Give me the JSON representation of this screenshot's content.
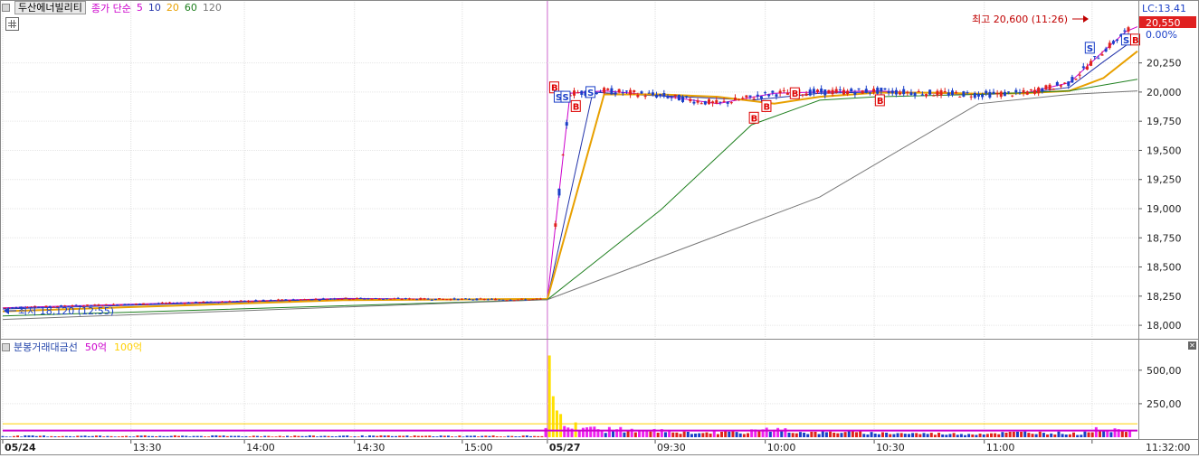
{
  "legend": {
    "stock_name": "두산에너빌리티",
    "ma_label": "종가 단순",
    "ma_periods": [
      {
        "label": "5",
        "color": "#cc00cc"
      },
      {
        "label": "10",
        "color": "#2233aa"
      },
      {
        "label": "20",
        "color": "#e8a000"
      },
      {
        "label": "60",
        "color": "#208020"
      },
      {
        "label": "120",
        "color": "#777777"
      }
    ]
  },
  "volume_legend": {
    "title": "분봉거래대금선",
    "line1": {
      "label": "50억",
      "color": "#cc00cc"
    },
    "line2": {
      "label": "100억",
      "color": "#ffd000"
    }
  },
  "annotations": {
    "high": "최고 20,600 (11:26)",
    "low": "최저 18,120 (12:55)",
    "lc": "LC:13.41",
    "current_price": "20,550",
    "current_pct": "0.00%"
  },
  "chart_data": {
    "type": "line",
    "title": "",
    "price_axis": {
      "ylim": [
        17900,
        20650
      ],
      "ticks": [
        "20,250",
        "20,000",
        "19,750",
        "19,500",
        "19,250",
        "19,000",
        "18,750",
        "18,500",
        "18,250",
        "18,000"
      ],
      "tick_values": [
        20250,
        20000,
        19750,
        19500,
        19250,
        19000,
        18750,
        18500,
        18250,
        18000
      ]
    },
    "volume_axis": {
      "ticks": [
        "500,00",
        "250,00"
      ],
      "tick_values": [
        500,
        250
      ],
      "ylim": [
        0,
        620
      ]
    },
    "time_axis": {
      "labels": [
        "05/24",
        "13:30",
        "14:00",
        "14:30",
        "15:00",
        "05/27",
        "09:30",
        "10:00",
        "10:30",
        "11:00",
        "11:32:00"
      ]
    },
    "series": [
      {
        "name": "5",
        "x": [
          0.0,
          0.3,
          0.46,
          0.48,
          0.5,
          0.53,
          0.58,
          0.63,
          0.68,
          0.72,
          0.77,
          0.82,
          0.86,
          0.9,
          0.94,
          0.97,
          0.99,
          1.0
        ],
        "values": [
          18150,
          18230,
          18220,
          18225,
          19990,
          20010,
          19970,
          19900,
          19990,
          20000,
          20010,
          19990,
          19980,
          19990,
          20080,
          20350,
          20520,
          20560
        ]
      },
      {
        "name": "10",
        "x": [
          0.0,
          0.3,
          0.46,
          0.48,
          0.52,
          0.55,
          0.6,
          0.66,
          0.72,
          0.77,
          0.82,
          0.86,
          0.9,
          0.94,
          0.97,
          1.0
        ],
        "values": [
          18140,
          18225,
          18220,
          18225,
          20000,
          19980,
          19960,
          19930,
          19990,
          20000,
          19995,
          19985,
          19990,
          20040,
          20260,
          20470
        ]
      },
      {
        "name": "20",
        "x": [
          0.0,
          0.3,
          0.46,
          0.48,
          0.53,
          0.58,
          0.63,
          0.68,
          0.72,
          0.77,
          0.82,
          0.86,
          0.9,
          0.94,
          0.97,
          1.0
        ],
        "values": [
          18120,
          18215,
          18225,
          18225,
          19980,
          19980,
          19960,
          19900,
          19960,
          19995,
          19995,
          19985,
          19990,
          20010,
          20120,
          20350
        ]
      },
      {
        "name": "60",
        "x": [
          0.0,
          0.48,
          0.58,
          0.66,
          0.72,
          0.77,
          0.86,
          0.94,
          1.0
        ],
        "values": [
          18080,
          18220,
          18990,
          19720,
          19930,
          19960,
          19980,
          20010,
          20110
        ]
      },
      {
        "name": "120",
        "x": [
          0.0,
          0.48,
          0.72,
          0.86,
          0.94,
          1.0
        ],
        "values": [
          18050,
          18220,
          19100,
          19900,
          19980,
          20010
        ]
      }
    ],
    "volume": {
      "x": [
        0.48,
        0.485,
        0.49,
        0.495,
        0.5,
        0.51,
        0.52,
        0.53,
        0.54,
        0.56,
        0.58,
        0.6,
        0.62,
        0.65,
        0.68,
        0.7,
        0.72,
        0.74,
        0.76,
        0.8,
        0.85,
        0.9,
        0.93,
        0.95,
        0.96,
        0.97,
        0.98,
        0.99
      ],
      "values": [
        610,
        300,
        230,
        150,
        120,
        100,
        80,
        60,
        80,
        50,
        60,
        40,
        50,
        40,
        80,
        45,
        40,
        50,
        40,
        35,
        30,
        45,
        40,
        30,
        70,
        65,
        80,
        70
      ]
    },
    "signals": [
      {
        "type": "B",
        "t": 0.486,
        "price": 20040
      },
      {
        "type": "S",
        "t": 0.49,
        "price": 19960
      },
      {
        "type": "S",
        "t": 0.496,
        "price": 19960
      },
      {
        "type": "B",
        "t": 0.505,
        "price": 19880
      },
      {
        "type": "S",
        "t": 0.518,
        "price": 20000
      },
      {
        "type": "B",
        "t": 0.662,
        "price": 19780
      },
      {
        "type": "B",
        "t": 0.673,
        "price": 19880
      },
      {
        "type": "B",
        "t": 0.698,
        "price": 19990
      },
      {
        "type": "B",
        "t": 0.773,
        "price": 19930
      },
      {
        "type": "S",
        "t": 0.958,
        "price": 20380
      },
      {
        "type": "S",
        "t": 0.99,
        "price": 20450
      },
      {
        "type": "B",
        "t": 0.998,
        "price": 20450
      }
    ],
    "grid": true
  }
}
